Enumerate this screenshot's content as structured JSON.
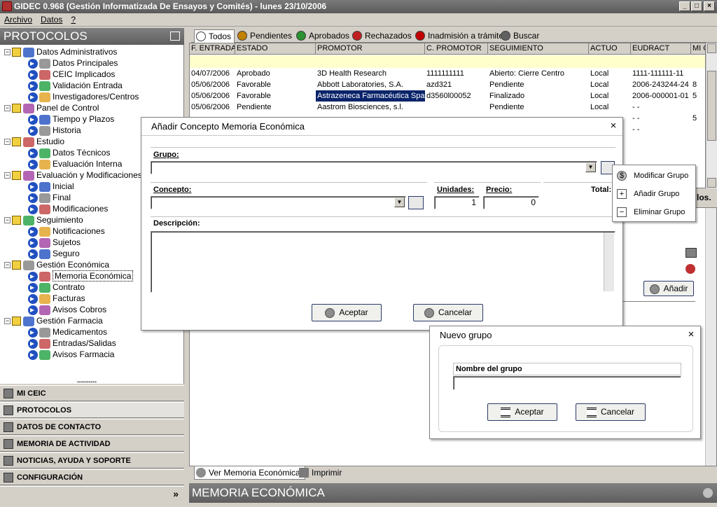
{
  "window": {
    "title": "GIDEC 0.968 (Gestión Informatizada De Ensayos y Comités) - lunes 23/10/2006",
    "min": "_",
    "max": "□",
    "close": "×"
  },
  "menu": [
    "Archivo",
    "Datos",
    "?"
  ],
  "left": {
    "header": "PROTOCOLOS",
    "tree": [
      {
        "label": "Datos Administrativos",
        "level": 0
      },
      {
        "label": "Datos Principales",
        "level": 1
      },
      {
        "label": "CEIC Implicados",
        "level": 1
      },
      {
        "label": "Validación Entrada",
        "level": 1
      },
      {
        "label": "Investigadores/Centros",
        "level": 1
      },
      {
        "label": "Panel de Control",
        "level": 0
      },
      {
        "label": "Tiempo y Plazos",
        "level": 1
      },
      {
        "label": "Historia",
        "level": 1
      },
      {
        "label": "Estudio",
        "level": 0
      },
      {
        "label": "Datos Técnicos",
        "level": 1
      },
      {
        "label": "Evaluación Interna",
        "level": 1
      },
      {
        "label": "Evaluación y Modificaciones",
        "level": 0
      },
      {
        "label": "Inicial",
        "level": 1
      },
      {
        "label": "Final",
        "level": 1
      },
      {
        "label": "Modificaciones",
        "level": 1
      },
      {
        "label": "Seguimiento",
        "level": 0
      },
      {
        "label": "Notificaciones",
        "level": 1
      },
      {
        "label": "Sujetos",
        "level": 1
      },
      {
        "label": "Seguro",
        "level": 1
      },
      {
        "label": "Gestión Económica",
        "level": 0
      },
      {
        "label": "Memoria Económica",
        "level": 1,
        "selected": true
      },
      {
        "label": "Contrato",
        "level": 1
      },
      {
        "label": "Facturas",
        "level": 1
      },
      {
        "label": "Avisos Cobros",
        "level": 1
      },
      {
        "label": "Gestión Farmacia",
        "level": 0
      },
      {
        "label": "Medicamentos",
        "level": 1
      },
      {
        "label": "Entradas/Salidas",
        "level": 1
      },
      {
        "label": "Avisos Farmacia",
        "level": 1
      }
    ],
    "splitter": "••••••••••",
    "nav": [
      "MI CEIC",
      "PROTOCOLOS",
      "DATOS DE CONTACTO",
      "MEMORIA DE ACTIVIDAD",
      "NOTICIAS, AYUDA Y SOPORTE",
      "CONFIGURACIÓN"
    ],
    "expand_glyph": "»"
  },
  "tabs": [
    "Todos",
    "Pendientes",
    "Aprobados",
    "Rechazados",
    "Inadmisión a trámite",
    "Buscar"
  ],
  "tab_colors": [
    "#ffffff",
    "#c08000",
    "#2a9030",
    "#c02020",
    "#c00000",
    "#606060"
  ],
  "grid": {
    "columns": [
      "F. ENTRADA",
      "ESTADO",
      "PROMOTOR",
      "C. PROMOTOR",
      "SEGUIMIENTO",
      "ACTUO",
      "EUDRACT",
      "MI C"
    ],
    "rows": [
      [
        "04/07/2006",
        "Aprobado",
        "3D Health Research",
        "1111111111",
        "Abierto: Cierre Centro",
        "Local",
        "1111-111111-11",
        ""
      ],
      [
        "05/06/2006",
        "Favorable",
        "Abbott Laboratories, S.A.",
        "azd321",
        "Pendiente",
        "Local",
        "2006-243244-24",
        "8"
      ],
      [
        "05/06/2006",
        "Favorable",
        "Astrazeneca Farmacéutica Spain",
        "d3560l00052",
        "Finalizado",
        "Local",
        "2006-000001-01",
        "5"
      ],
      [
        "05/06/2006",
        "Pendiente",
        "Aastrom Biosciences, s.l.",
        "",
        "Pendiente",
        "Local",
        "-    -",
        ""
      ],
      [
        "",
        "",
        "",
        "",
        "",
        "",
        "-    -",
        "5"
      ],
      [
        "",
        "",
        "",
        "",
        "",
        "",
        "-    -",
        ""
      ]
    ]
  },
  "lower": {
    "tabs": [
      "Ver Memoria Económica",
      "Imprimir"
    ],
    "footer": "MEMORIA ECONÓMICA",
    "side_label": "los.",
    "add_button": "Añadir"
  },
  "dialog_concepto": {
    "title": "Añadir Concepto Memoria Económica",
    "grupo_label": "Grupo:",
    "concepto_label": "Concepto:",
    "unidades_label": "Unidades:",
    "unidades_value": "1",
    "precio_label": "Precio:",
    "precio_value": "0",
    "total_label": "Total:",
    "descripcion_label": "Descripción:",
    "accept": "Aceptar",
    "cancel": "Cancelar"
  },
  "context_menu": [
    {
      "label": "Modificar Grupo",
      "icon": "money-bag-icon"
    },
    {
      "label": "Añadir Grupo",
      "icon": "plus-icon"
    },
    {
      "label": "Eliminar Grupo",
      "icon": "minus-icon"
    }
  ],
  "dialog_grupo": {
    "title": "Nuevo grupo",
    "nombre_label": "Nombre del grupo",
    "accept": "Aceptar",
    "cancel": "Cancelar"
  }
}
